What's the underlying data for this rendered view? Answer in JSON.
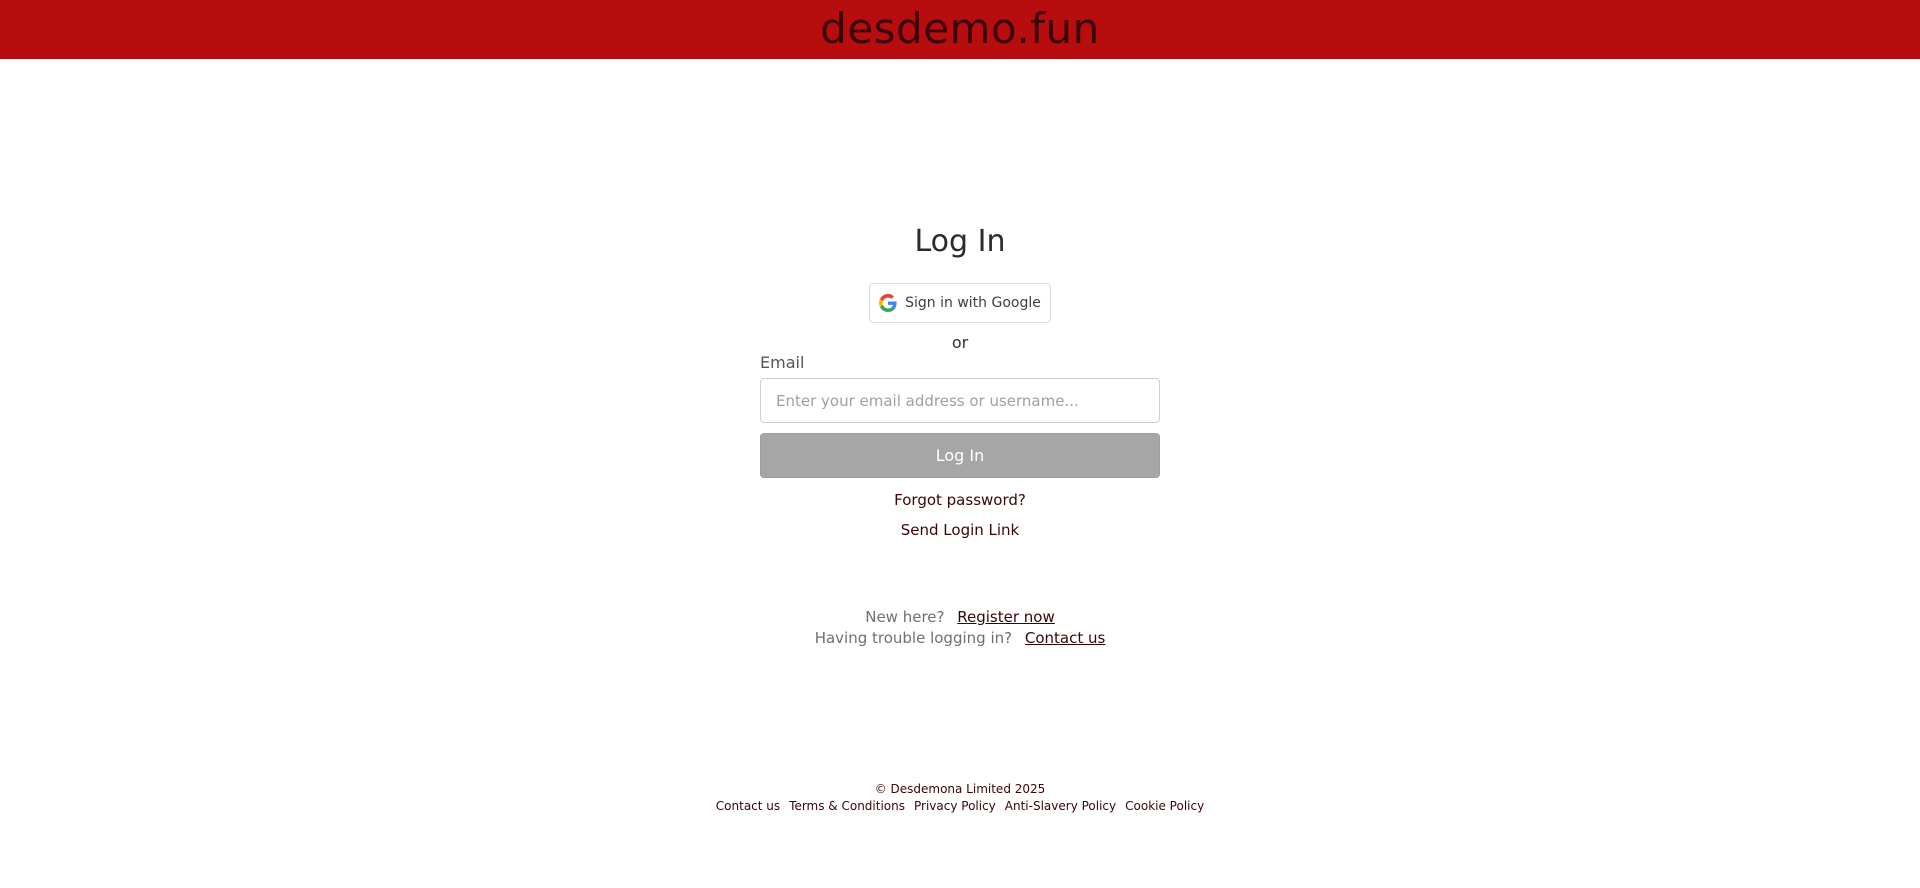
{
  "header": {
    "brand": "desdemo.fun",
    "background_color": "#b80d0f",
    "brand_color": "#3a0508"
  },
  "login": {
    "title": "Log In",
    "google_button_label": "Sign in with Google",
    "google_icon": "google-g-icon",
    "or_text": "or",
    "email_label": "Email",
    "email_placeholder": "Enter your email address or username...",
    "email_value": "",
    "login_button_label": "Log In",
    "forgot_password": "Forgot password?",
    "send_login_link": "Send Login Link"
  },
  "extras": {
    "new_here_text": "New here?",
    "register_link": "Register now",
    "trouble_text": "Having trouble logging in?",
    "contact_link": "Contact us"
  },
  "footer": {
    "copyright": "© Desdemona Limited  2025",
    "links": [
      "Contact us",
      "Terms & Conditions",
      "Privacy Policy",
      "Anti-Slavery Policy",
      "Cookie Policy"
    ]
  }
}
